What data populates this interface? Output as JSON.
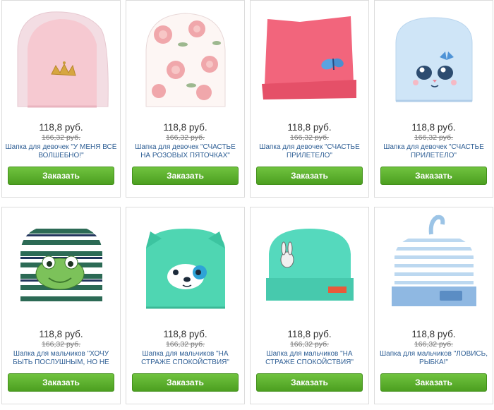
{
  "products": [
    {
      "price": "118,8 руб.",
      "old_price": "166,32 руб.",
      "name": "Шапка для девочек \"У МЕНЯ ВСЁ ВОЛШЕБНО!\"",
      "button": "Заказать"
    },
    {
      "price": "118,8 руб.",
      "old_price": "166,32 руб.",
      "name": "Шапка для девочек \"СЧАСТЬЕ НА РОЗОВЫХ ПЯТОЧКАХ\"",
      "button": "Заказать"
    },
    {
      "price": "118,8 руб.",
      "old_price": "166,32 руб.",
      "name": "Шапка для девочек \"СЧАСТЬЕ ПРИЛЕТЕЛО\"",
      "button": "Заказать"
    },
    {
      "price": "118,8 руб.",
      "old_price": "166,32 руб.",
      "name": "Шапка для девочек \"СЧАСТЬЕ ПРИЛЕТЕЛО\"",
      "button": "Заказать"
    },
    {
      "price": "118,8 руб.",
      "old_price": "166,32 руб.",
      "name": "Шапка для мальчиков \"ХОЧУ БЫТЬ ПОСЛУШНЫМ, НО НЕ",
      "button": "Заказать"
    },
    {
      "price": "118,8 руб.",
      "old_price": "166,32 руб.",
      "name": "Шапка для мальчиков \"НА СТРАЖЕ СПОКОЙСТВИЯ\"",
      "button": "Заказать"
    },
    {
      "price": "118,8 руб.",
      "old_price": "166,32 руб.",
      "name": "Шапка для мальчиков \"НА СТРАЖЕ СПОКОЙСТВИЯ\"",
      "button": "Заказать"
    },
    {
      "price": "118,8 руб.",
      "old_price": "166,32 руб.",
      "name": "Шапка для мальчиков \"ЛОВИСЬ, РЫБКА!\"",
      "button": "Заказать"
    }
  ],
  "colors": {
    "button": "#5aaf2c",
    "link": "#2f5f95"
  }
}
